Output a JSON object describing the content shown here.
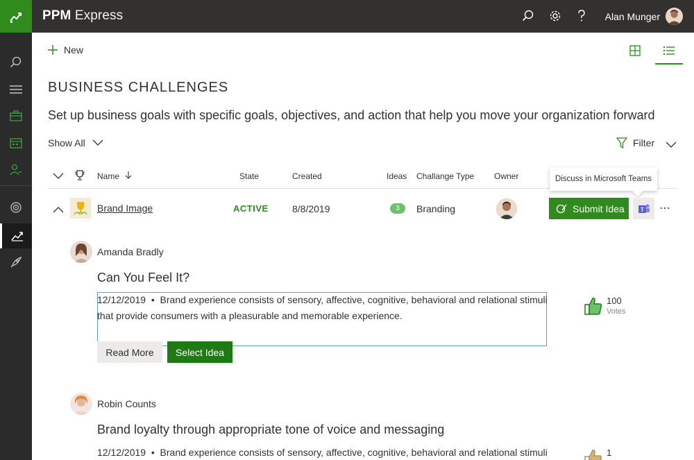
{
  "app": {
    "brand_bold": "PPM",
    "brand_light": "Express"
  },
  "user": {
    "name": "Alan Munger"
  },
  "toolbar": {
    "new_label": "New"
  },
  "page": {
    "title": "BUSINESS CHALLENGES",
    "subtitle": "Set up business goals with specific goals, objectives, and action that help you move your organization forward"
  },
  "filters": {
    "show_all": "Show All",
    "filter": "Filter"
  },
  "table": {
    "headers": {
      "name": "Name",
      "state": "State",
      "created": "Created",
      "ideas": "Ideas",
      "type": "Challange Type",
      "owner": "Owner"
    },
    "row": {
      "name": "Brand Image",
      "state": "ACTIVE",
      "created": "8/8/2019",
      "ideas": "3",
      "type": "Branding",
      "submit_label": "Submit Idea"
    }
  },
  "tooltip": {
    "text": "Discuss in Microsoft Teams"
  },
  "ideas": [
    {
      "author": "Amanda Bradly",
      "title": "Can You Feel It?",
      "date": "12/12/2019",
      "text_line1": "Brand experience consists of sensory, affective, cognitive, behavioral and relational stimuli",
      "text_line2": "that provide consumers with a pleasurable and memorable experience.",
      "votes": "100",
      "votes_label": "Votes",
      "read_more": "Read More",
      "select": "Select Idea"
    },
    {
      "author": "Robin Counts",
      "title": "Brand loyalty through appropriate tone of voice and messaging",
      "date": "12/12/2019",
      "text_line1": "Brand experience consists of sensory, affective, cognitive, behavioral and relational stimuli",
      "votes": "1"
    }
  ],
  "colors": {
    "accent": "#2e8b1c",
    "topbar": "#323130",
    "rail": "#2b2b2b"
  }
}
